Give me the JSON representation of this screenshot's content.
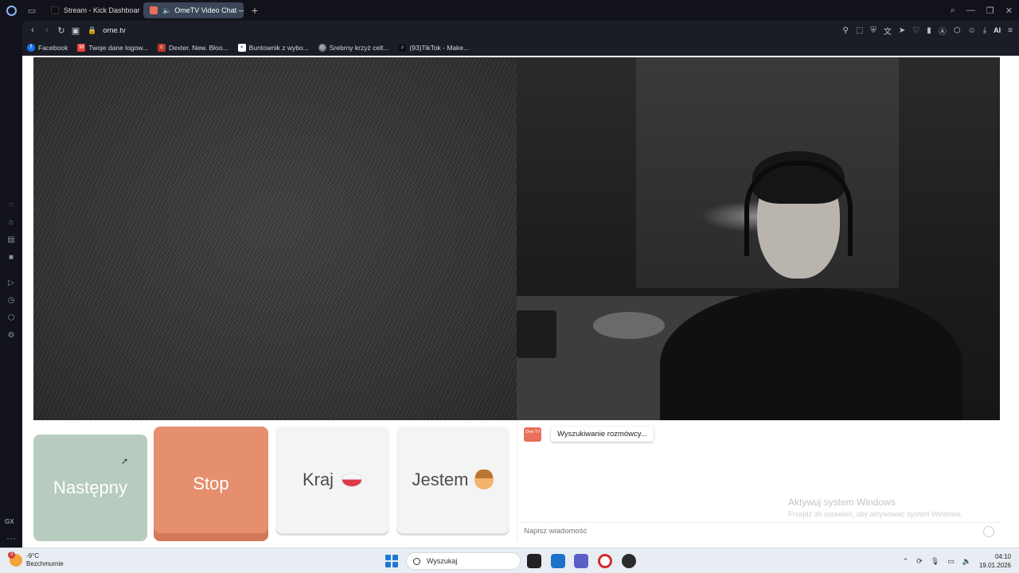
{
  "browser": {
    "tabs": [
      {
        "label": "Stream - Kick Dashboard",
        "active": false
      },
      {
        "label": "OmeTV Video Chat —",
        "active": true
      }
    ],
    "url": "ome.tv",
    "ai_label": "AI",
    "bookmarks": [
      {
        "label": "Facebook",
        "color": "#1877f2"
      },
      {
        "label": "Twoje dane logow...",
        "color": "#ea4335"
      },
      {
        "label": "Dexter. New. Bloo...",
        "color": "#c0392b"
      },
      {
        "label": "Buntownik z wybo...",
        "color": "#ffffff"
      },
      {
        "label": "Srebrny krzyż celt...",
        "color": "#777777"
      },
      {
        "label": "(93)TikTok - Make...",
        "color": "#111111"
      }
    ],
    "sidebar_gx": "GX",
    "sidebar_more": "···"
  },
  "controls": {
    "next_label": "Następny",
    "stop_label": "Stop",
    "country_label": "Kraj",
    "gender_label": "Jestem"
  },
  "chat": {
    "logo_text": "Ome TV",
    "status_message": "Wyszukiwanie rozmówcy...",
    "input_placeholder": "Napisz wiadomość"
  },
  "watermark": {
    "title": "Aktywuj system Windows",
    "subtitle": "Przejdź do ustawień, aby aktywować system Windows."
  },
  "taskbar": {
    "weather_badge": "3",
    "temperature": "-9°C",
    "weather_desc": "Bezchmurnie",
    "search_placeholder": "Wyszukaj",
    "time": "04:10",
    "date": "19.01.2026"
  },
  "colors": {
    "next_button": "#b8cbbf",
    "stop_button": "#e58f6e",
    "brand": "#e86f5a"
  }
}
